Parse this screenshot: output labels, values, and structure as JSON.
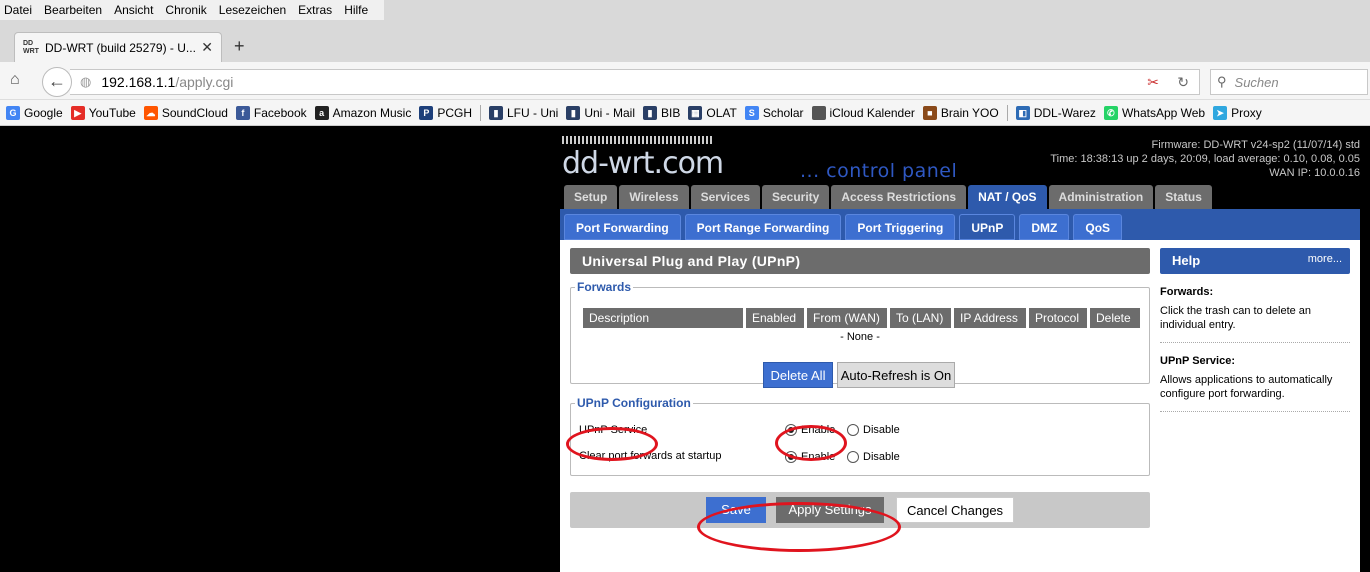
{
  "menubar": [
    "Datei",
    "Bearbeiten",
    "Ansicht",
    "Chronik",
    "Lesezeichen",
    "Extras",
    "Hilfe"
  ],
  "tab": {
    "title": "DD-WRT (build 25279) - U...",
    "favicon": "DD\nWRT",
    "close": "✕",
    "new": "+"
  },
  "url": {
    "host": "192.168.1.1",
    "path": "/apply.cgi"
  },
  "search": {
    "placeholder": "Suchen"
  },
  "bookmarks": [
    {
      "label": "Google",
      "color": "#4285f4",
      "icon": "G"
    },
    {
      "label": "YouTube",
      "color": "#e52d27",
      "icon": "▶"
    },
    {
      "label": "SoundCloud",
      "color": "#ff5500",
      "icon": "☁"
    },
    {
      "label": "Facebook",
      "color": "#3b5998",
      "icon": "f"
    },
    {
      "label": "Amazon Music",
      "color": "#222",
      "icon": "a"
    },
    {
      "label": "PCGH",
      "color": "#1d3f7a",
      "icon": "P"
    },
    {
      "label": "LFU - Uni",
      "color": "#2a3f66",
      "icon": "▮"
    },
    {
      "label": "Uni - Mail",
      "color": "#2a3f66",
      "icon": "▮"
    },
    {
      "label": "BIB",
      "color": "#2a3f66",
      "icon": "▮"
    },
    {
      "label": "OLAT",
      "color": "#2a3f66",
      "icon": "▦"
    },
    {
      "label": "Scholar",
      "color": "#4285f4",
      "icon": "S"
    },
    {
      "label": "iCloud Kalender",
      "color": "#555",
      "icon": ""
    },
    {
      "label": "Brain YOO",
      "color": "#8a4a1a",
      "icon": "■"
    },
    {
      "label": "DDL-Warez",
      "color": "#2d6bb5",
      "icon": "◧"
    },
    {
      "label": "WhatsApp Web",
      "color": "#25d366",
      "icon": "✆"
    },
    {
      "label": "Proxy",
      "color": "#2fa7df",
      "icon": "➤"
    }
  ],
  "ddwrt": {
    "logo": "dd-wrt.com",
    "panel": "... control panel",
    "firmware": "Firmware: DD-WRT v24-sp2 (11/07/14) std",
    "time": "Time: 18:38:13 up 2 days, 20:09, load average: 0.10, 0.08, 0.05",
    "wan": "WAN IP: 10.0.0.16",
    "maintabs": [
      "Setup",
      "Wireless",
      "Services",
      "Security",
      "Access Restrictions",
      "NAT / QoS",
      "Administration",
      "Status"
    ],
    "subtabs": [
      "Port Forwarding",
      "Port Range Forwarding",
      "Port Triggering",
      "UPnP",
      "DMZ",
      "QoS"
    ],
    "page_title": "Universal Plug and Play (UPnP)",
    "forwards": {
      "legend": "Forwards",
      "columns": [
        "Description",
        "Enabled",
        "From (WAN)",
        "To (LAN)",
        "IP Address",
        "Protocol",
        "Delete"
      ],
      "empty": "- None -",
      "delete_all": "Delete All",
      "auto_refresh": "Auto-Refresh is On"
    },
    "config": {
      "legend": "UPnP Configuration",
      "upnp_service": "UPnP Service",
      "clear_forwards": "Clear port forwards at startup",
      "enable": "Enable",
      "disable": "Disable"
    },
    "buttons": {
      "save": "Save",
      "apply": "Apply Settings",
      "cancel": "Cancel Changes"
    },
    "help": {
      "title": "Help",
      "more": "more...",
      "forwards_title": "Forwards:",
      "forwards_text": "Click the trash can to delete an individual entry.",
      "upnp_title": "UPnP Service:",
      "upnp_text": "Allows applications to automatically configure port forwarding."
    }
  }
}
